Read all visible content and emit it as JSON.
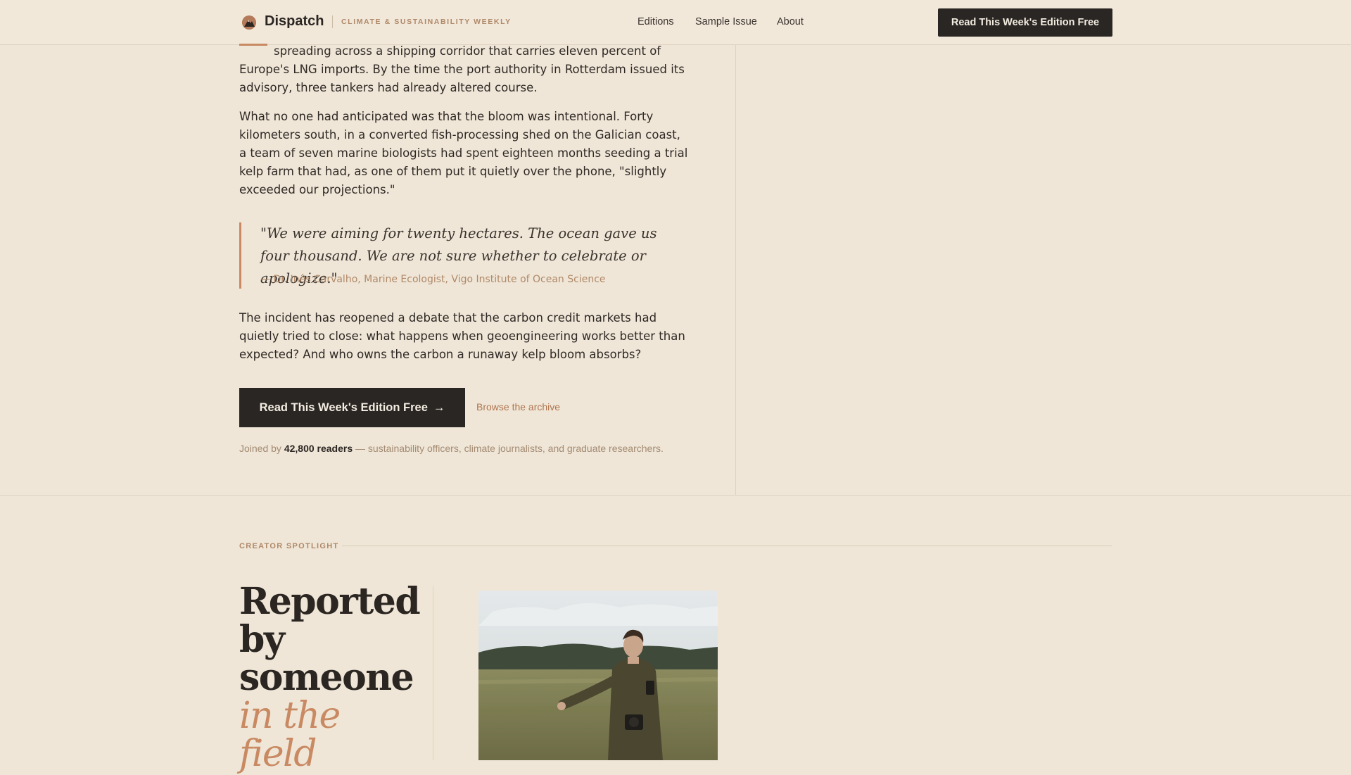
{
  "header": {
    "brand": "Dispatch",
    "tagline": "CLIMATE & SUSTAINABILITY WEEKLY",
    "nav": [
      "Editions",
      "Sample Issue",
      "About"
    ],
    "cta": "Read This Week's Edition Free"
  },
  "article": {
    "p1_first_line": "spreading across a shipping corridor that carries eleven percent of",
    "p1_rest": "Europe's LNG imports. By the time the port authority in Rotterdam issued its advisory, three tankers had already altered course.",
    "p2": "What no one had anticipated was that the bloom was intentional. Forty kilometers south, in a converted fish-processing shed on the Galician coast, a team of seven marine biologists had spent eighteen months seeding a trial kelp farm that had, as one of them put it quietly over the phone, \"slightly exceeded our projections.\"",
    "quote": "\"We were aiming for twenty hectares. The ocean gave us four thousand. We are not sure whether to celebrate or apologize.\"",
    "quote_attribution": "— Dr. Inês Carvalho, Marine Ecologist, Vigo Institute of Ocean Science",
    "p3": "The incident has reopened a debate that the carbon credit markets had quietly tried to close: what happens when geoengineering works better than expected? And who owns the carbon a runaway kelp bloom absorbs?",
    "cta": "Read This Week's Edition Free",
    "cta_arrow": "→",
    "archive_link": "Browse the archive",
    "joined_prefix": "Joined by",
    "joined_count": "42,800 readers",
    "joined_suffix": "— sustainability officers, climate journalists, and graduate researchers."
  },
  "spotlight": {
    "label": "CREATOR SPOTLIGHT",
    "headline_lines": [
      "Reported",
      "by",
      "someone"
    ],
    "headline_italic_lines": [
      "in the",
      "field"
    ]
  },
  "colors": {
    "background": "#efe6d7",
    "accent": "#c98a63",
    "dark_button": "#2a2623",
    "muted_text": "#b08868"
  }
}
